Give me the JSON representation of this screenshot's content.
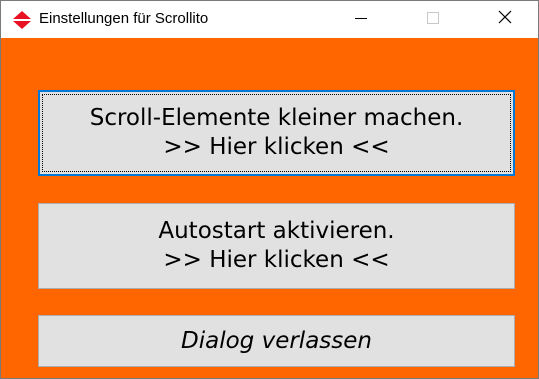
{
  "window": {
    "title": "Einstellungen für Scrollito",
    "app_icon": "red-diamond-arrows-icon",
    "caption": {
      "minimize_icon": "minimize-icon",
      "maximize_icon": "maximize-icon",
      "close_icon": "close-icon"
    }
  },
  "colors": {
    "background": "#ff6600",
    "button_face": "#e1e1e1",
    "focus_border": "#0078d7",
    "icon_red": "#e81123"
  },
  "buttons": [
    {
      "line1": "Scroll-Elemente kleiner machen.",
      "line2": ">> Hier klicken <<",
      "focused": true
    },
    {
      "line1": "Autostart aktivieren.",
      "line2": ">> Hier klicken <<",
      "focused": false
    },
    {
      "label": "Dialog verlassen",
      "italic": true
    }
  ]
}
